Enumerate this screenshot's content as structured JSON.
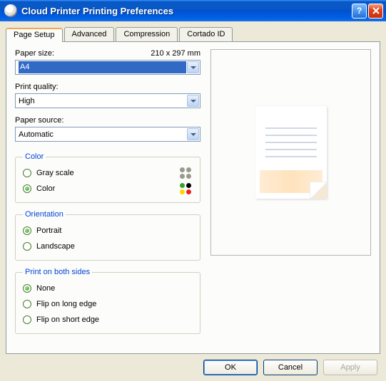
{
  "window": {
    "title": "Cloud Printer Printing Preferences"
  },
  "tabs": [
    {
      "label": "Page Setup"
    },
    {
      "label": "Advanced"
    },
    {
      "label": "Compression"
    },
    {
      "label": "Cortado ID"
    }
  ],
  "paper": {
    "size_label": "Paper size:",
    "dimensions": "210 x 297 mm",
    "size_value": "A4",
    "quality_label": "Print quality:",
    "quality_value": "High",
    "source_label": "Paper source:",
    "source_value": "Automatic"
  },
  "color": {
    "legend": "Color",
    "gray": "Gray scale",
    "color": "Color"
  },
  "orientation": {
    "legend": "Orientation",
    "portrait": "Portrait",
    "landscape": "Landscape"
  },
  "duplex": {
    "legend": "Print on both sides",
    "none": "None",
    "long": "Flip on long edge",
    "short": "Flip on short edge"
  },
  "buttons": {
    "ok": "OK",
    "cancel": "Cancel",
    "apply": "Apply"
  }
}
